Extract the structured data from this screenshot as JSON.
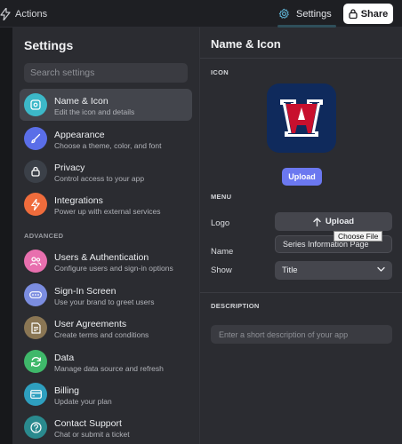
{
  "topbar": {
    "actions_label": "Actions",
    "settings_label": "Settings",
    "share_label": "Share"
  },
  "sidebar": {
    "title": "Settings",
    "search_placeholder": "Search settings",
    "section_advanced": "ADVANCED",
    "items": [
      {
        "label": "Name & Icon",
        "desc": "Edit the icon and details",
        "icon": "app-icon",
        "color": "#3cb8c8",
        "active": true
      },
      {
        "label": "Appearance",
        "desc": "Choose a theme, color, and font",
        "icon": "brush-icon",
        "color": "#5a6ee8"
      },
      {
        "label": "Privacy",
        "desc": "Control access to your app",
        "icon": "lock-icon",
        "color": "#3b4048"
      },
      {
        "label": "Integrations",
        "desc": "Power up with external services",
        "icon": "bolt-icon",
        "color": "#ef6c3c"
      },
      {
        "label": "Users & Authentication",
        "desc": "Configure users and sign-in options",
        "icon": "users-icon",
        "color": "#e86fae"
      },
      {
        "label": "Sign-In Screen",
        "desc": "Use your brand to greet users",
        "icon": "password-icon",
        "color": "#7b8de0"
      },
      {
        "label": "User Agreements",
        "desc": "Create terms and conditions",
        "icon": "document-icon",
        "color": "#8a7654"
      },
      {
        "label": "Data",
        "desc": "Manage data source and refresh",
        "icon": "refresh-icon",
        "color": "#3fb86a"
      },
      {
        "label": "Billing",
        "desc": "Update your plan",
        "icon": "card-icon",
        "color": "#2e9fbf"
      },
      {
        "label": "Contact Support",
        "desc": "Chat or submit a ticket",
        "icon": "help-icon",
        "color": "#2a8a8e"
      }
    ]
  },
  "panel": {
    "title": "Name & Icon",
    "icon_section": "ICON",
    "upload_label": "Upload",
    "menu_section": "MENU",
    "logo_label": "Logo",
    "logo_button": "Upload",
    "tooltip": "Choose File",
    "name_label": "Name",
    "name_value": "Series Information Page",
    "show_label": "Show",
    "show_value": "Title",
    "description_section": "DESCRIPTION",
    "description_placeholder": "Enter a short description of your app"
  },
  "colors": {
    "accent": "#6b78f0",
    "app_icon_bg": "#0f2a5c",
    "logo_red": "#c8102e"
  }
}
